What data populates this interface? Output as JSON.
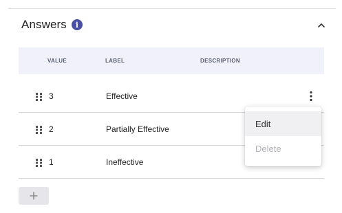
{
  "section": {
    "title": "Answers",
    "info_glyph": "i"
  },
  "table": {
    "columns": [
      "VALUE",
      "LABEL",
      "DESCRIPTION"
    ],
    "rows": [
      {
        "value": "3",
        "label": "Effective",
        "description": ""
      },
      {
        "value": "2",
        "label": "Partially Effective",
        "description": ""
      },
      {
        "value": "1",
        "label": "Ineffective",
        "description": ""
      }
    ]
  },
  "context_menu": {
    "items": [
      {
        "label": "Edit",
        "enabled": true
      },
      {
        "label": "Delete",
        "enabled": false
      }
    ]
  },
  "icons": {
    "info": "info-icon",
    "collapse": "chevron-up-icon",
    "drag": "drag-handle-icon",
    "more": "kebab-menu-icon",
    "add": "plus-icon"
  },
  "colors": {
    "accent": "#4b4fa3",
    "header_bg": "#f0f1fb",
    "add_button_bg": "#e6e6ea"
  }
}
